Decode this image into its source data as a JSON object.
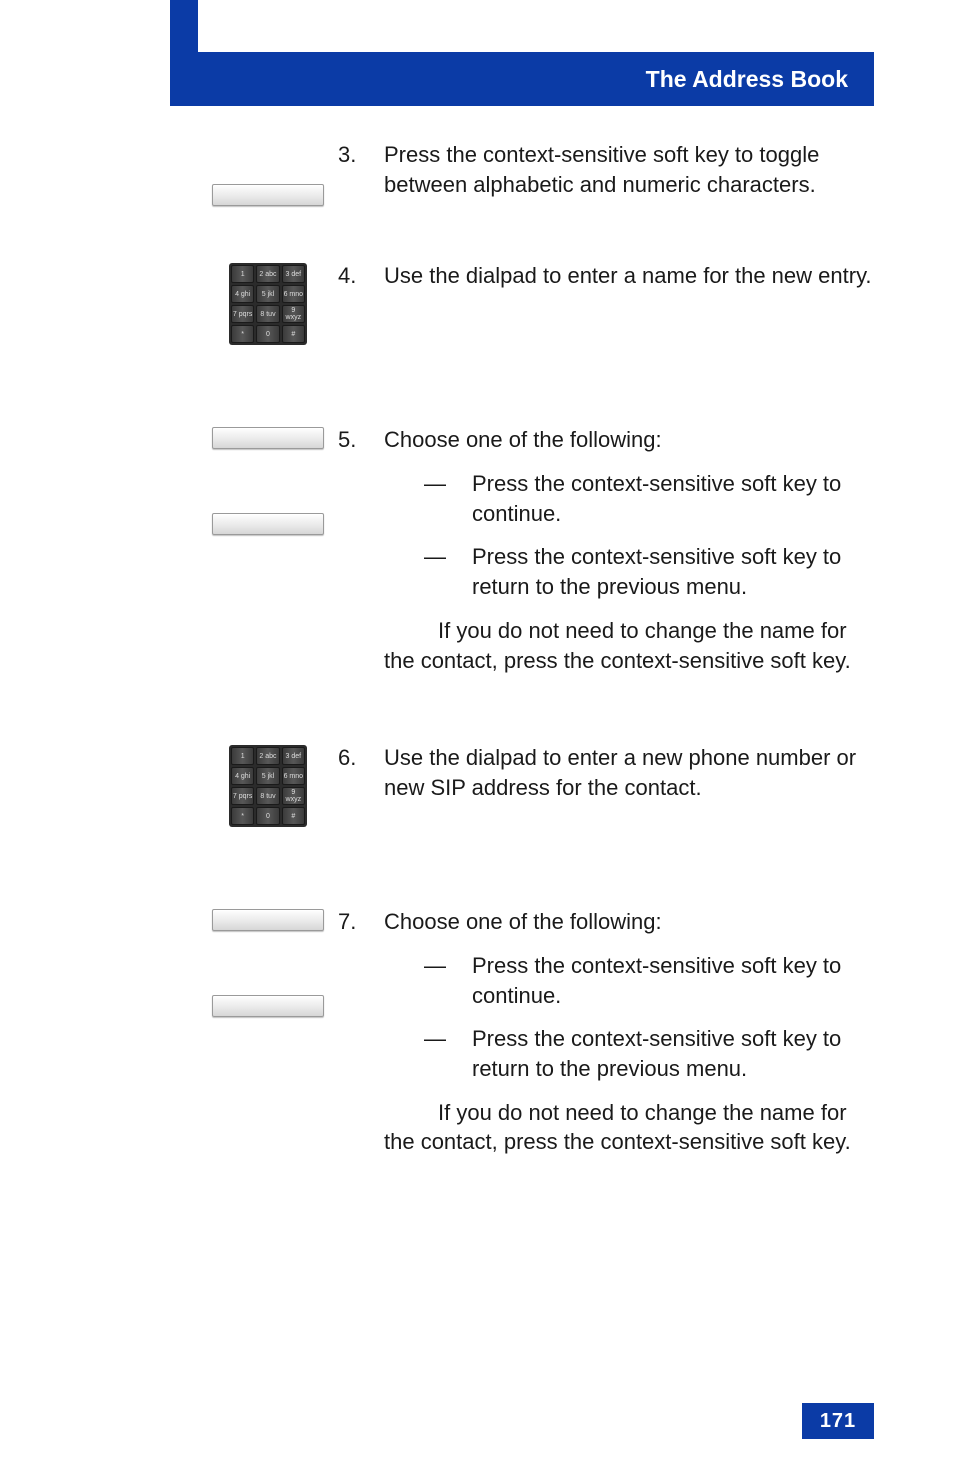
{
  "header": {
    "title": "The Address Book"
  },
  "page_number": "171",
  "dialpad_keys": [
    "1",
    "2 abc",
    "3 def",
    "4 ghi",
    "5 jkl",
    "6 mno",
    "7 pqrs",
    "8 tuv",
    "9 wxyz",
    "*",
    "0",
    "#"
  ],
  "steps": {
    "s3": {
      "num": "3.",
      "text_a": "Press the ",
      "text_b": " context-sensitive soft key to toggle between alphabetic and numeric characters."
    },
    "s4": {
      "num": "4.",
      "text": "Use the dialpad to enter a name for the new entry."
    },
    "s5": {
      "num": "5.",
      "intro": "Choose one of the following:",
      "a_pre": "Press the ",
      "a_post": " context-sensitive soft key to continue.",
      "b_pre": "Press the ",
      "b_post": " context-sensitive soft key to return to the previous menu.",
      "tip": "If you do not need to change the name for the contact, press the ",
      "tip_post": "context-sensitive soft key."
    },
    "s6": {
      "num": "6.",
      "text": "Use the dialpad to enter a new phone number or new SIP address for the contact."
    },
    "s7": {
      "num": "7.",
      "intro": "Choose one of the following:",
      "a_pre": "Press the ",
      "a_post": " context-sensitive soft key to continue.",
      "b_pre": "Press the ",
      "b_post": " context-sensitive soft key to return to the previous menu.",
      "tip": "If you do not need to change the name for the contact, press the ",
      "tip_post": "context-sensitive soft key."
    }
  },
  "dash": "—"
}
